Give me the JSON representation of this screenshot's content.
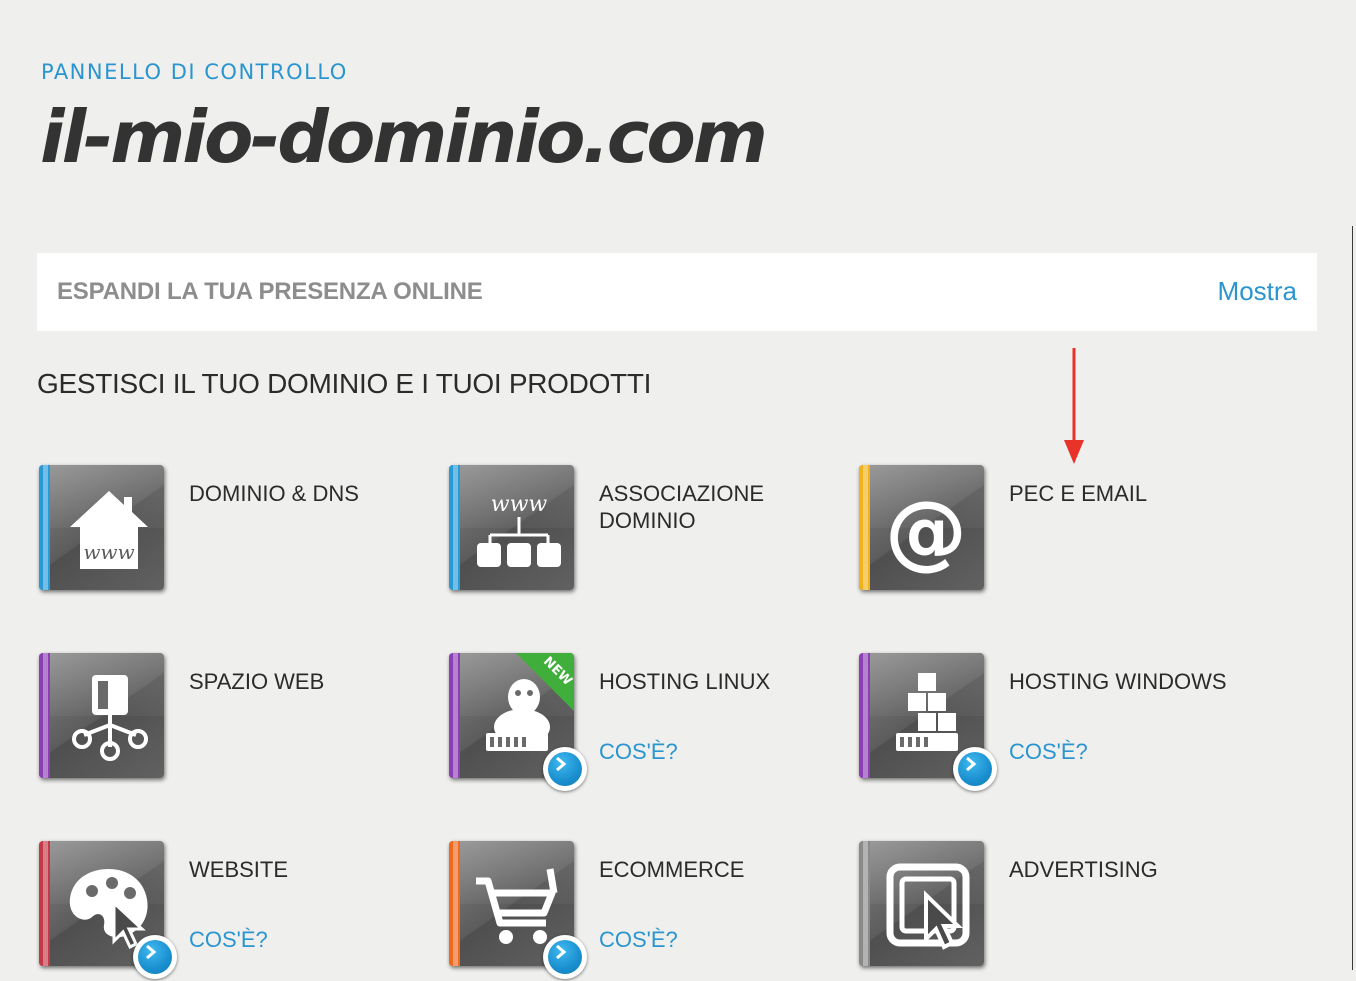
{
  "header": {
    "eyebrow": "PANNELLO DI CONTROLLO",
    "title": "il-mio-dominio.com"
  },
  "banner": {
    "title": "ESPANDI LA TUA PRESENZA ONLINE",
    "link": "Mostra"
  },
  "section": {
    "title": "GESTISCI IL TUO DOMINIO E I TUOI PRODOTTI"
  },
  "colors": {
    "accent": "#2a95cf",
    "annotation_arrow": "#e8322a",
    "strip_blue": "#2a9ad6",
    "strip_yellow": "#f2b21c",
    "strip_purple": "#8c3fb4",
    "strip_red": "#c23a46",
    "strip_orange": "#ef6a1f",
    "strip_gray": "#8a8a8a",
    "new_badge": "#3fae3a"
  },
  "products": [
    {
      "label": "DOMINIO & DNS",
      "icon": "www-home-icon",
      "strip": "blue",
      "info": ""
    },
    {
      "label": "ASSOCIAZIONE DOMINIO",
      "icon": "www-network-icon",
      "strip": "blue",
      "info": ""
    },
    {
      "label": "PEC E EMAIL",
      "icon": "at-sign-icon",
      "strip": "yellow",
      "info": ""
    },
    {
      "label": "SPAZIO WEB",
      "icon": "server-nodes-icon",
      "strip": "purple",
      "info": ""
    },
    {
      "label": "HOSTING LINUX",
      "icon": "linux-penguin-icon",
      "strip": "purple",
      "info": "COS'È?",
      "badge": "NEW"
    },
    {
      "label": "HOSTING WINDOWS",
      "icon": "stacked-cubes-icon",
      "strip": "purple",
      "info": "COS'È?"
    },
    {
      "label": "WEBSITE",
      "icon": "palette-cursor-icon",
      "strip": "red",
      "info": "COS'È?"
    },
    {
      "label": "ECOMMERCE",
      "icon": "shopping-cart-icon",
      "strip": "orange",
      "info": "COS'È?"
    },
    {
      "label": "ADVERTISING",
      "icon": "click-frame-icon",
      "strip": "gray",
      "info": ""
    }
  ]
}
